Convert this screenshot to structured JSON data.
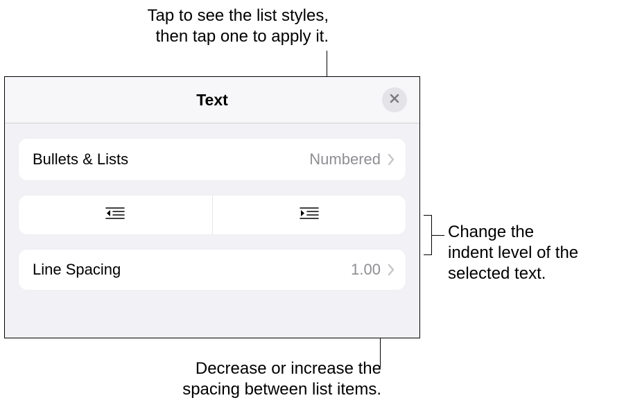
{
  "callouts": {
    "top": "Tap to see the list styles,\nthen tap one to apply it.",
    "right": "Change the\nindent level of the\nselected text.",
    "bottom": "Decrease or increase the\nspacing between list items."
  },
  "panel": {
    "title": "Text",
    "bullets": {
      "label": "Bullets & Lists",
      "value": "Numbered"
    },
    "lineSpacing": {
      "label": "Line Spacing",
      "value": "1.00"
    }
  }
}
